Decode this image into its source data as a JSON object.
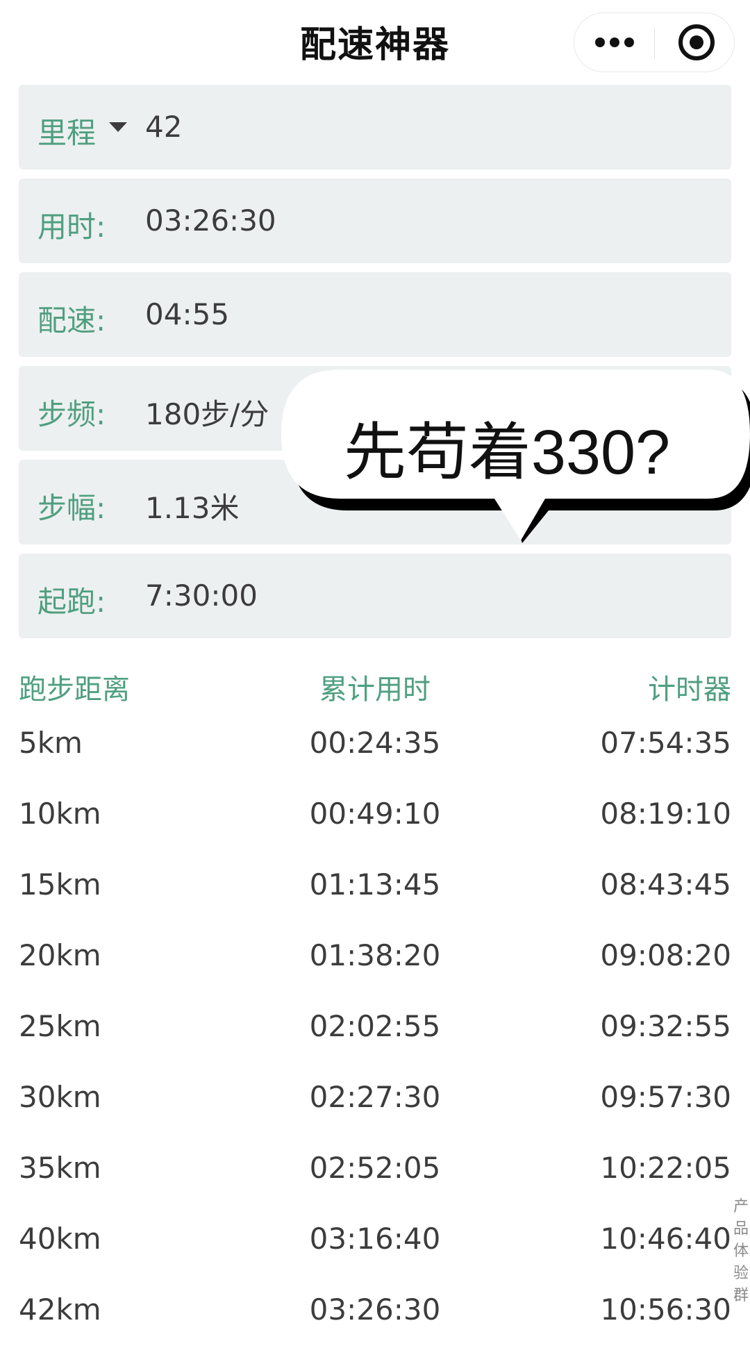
{
  "header": {
    "title": "配速神器"
  },
  "fields": {
    "distance": {
      "label": "里程",
      "value": "42"
    },
    "time": {
      "label": "用时:",
      "value": "03:26:30"
    },
    "pace": {
      "label": "配速:",
      "value": "04:55"
    },
    "cadence": {
      "label": "步频:",
      "value": "180步/分"
    },
    "stride": {
      "label": "步幅:",
      "value": "1.13米"
    },
    "start": {
      "label": "起跑:",
      "value": "7:30:00"
    }
  },
  "annotation": {
    "text": "先苟着330?"
  },
  "table": {
    "headers": [
      "跑步距离",
      "累计用时",
      "计时器"
    ],
    "rows": [
      [
        "5km",
        "00:24:35",
        "07:54:35"
      ],
      [
        "10km",
        "00:49:10",
        "08:19:10"
      ],
      [
        "15km",
        "01:13:45",
        "08:43:45"
      ],
      [
        "20km",
        "01:38:20",
        "09:08:20"
      ],
      [
        "25km",
        "02:02:55",
        "09:32:55"
      ],
      [
        "30km",
        "02:27:30",
        "09:57:30"
      ],
      [
        "35km",
        "02:52:05",
        "10:22:05"
      ],
      [
        "40km",
        "03:16:40",
        "10:46:40"
      ],
      [
        "42km",
        "03:26:30",
        "10:56:30"
      ]
    ]
  },
  "sidebar": {
    "chars": [
      "产",
      "品",
      "体",
      "验",
      "群"
    ]
  },
  "icons": {
    "more": "more-dots-icon",
    "close": "target-close-icon"
  },
  "colors": {
    "accent": "#4f9f80",
    "field_bg": "#edf0f0"
  }
}
